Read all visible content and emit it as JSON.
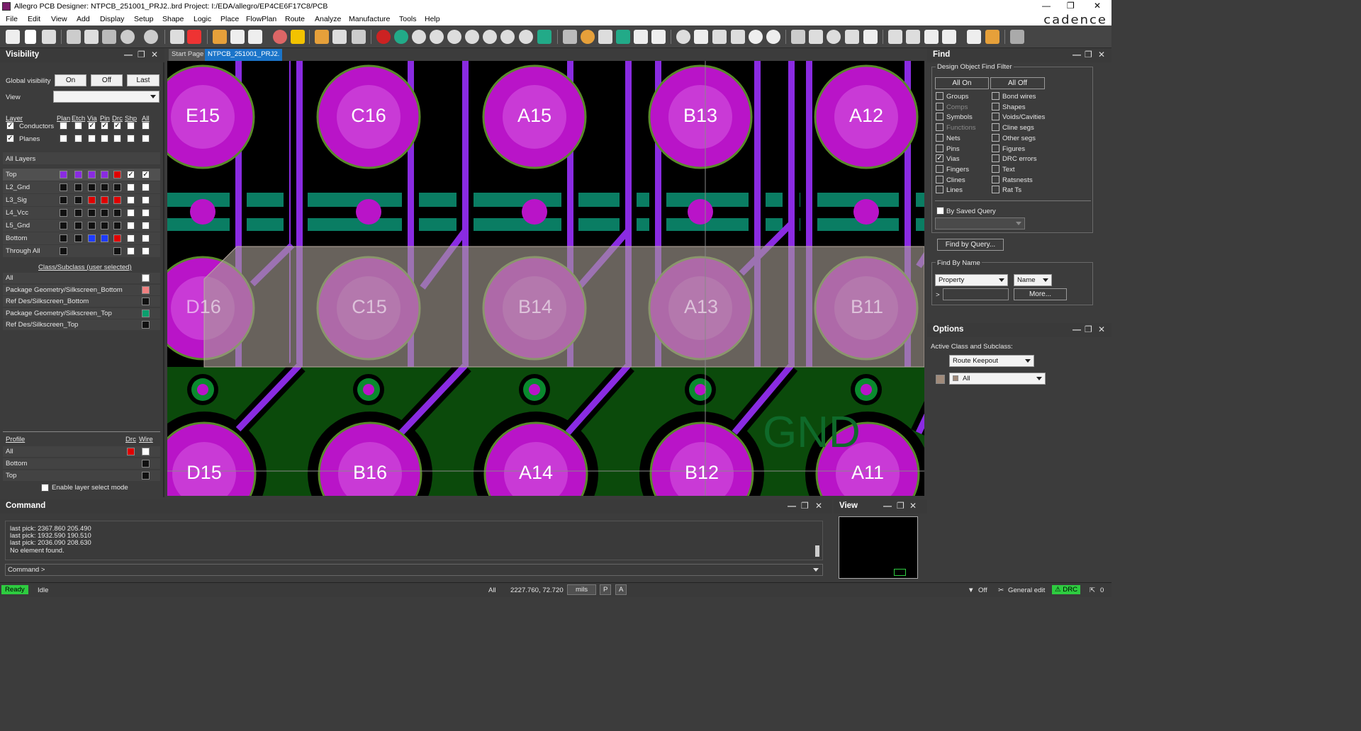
{
  "window": {
    "title": "Allegro PCB Designer: NTPCB_251001_PRJ2..brd  Project: I:/EDA/allegro/EP4CE6F17C8/PCB",
    "brand": "cadence"
  },
  "menu": [
    "File",
    "Edit",
    "View",
    "Add",
    "Display",
    "Setup",
    "Shape",
    "Logic",
    "Place",
    "FlowPlan",
    "Route",
    "Analyze",
    "Manufacture",
    "Tools",
    "Help"
  ],
  "visibility": {
    "title": "Visibility",
    "global_label": "Global visibility",
    "on": "On",
    "off": "Off",
    "last": "Last",
    "view_label": "View",
    "view_value": "",
    "headers": {
      "layer": "Layer",
      "plan": "Plan",
      "etch": "Etch",
      "via": "Via",
      "pin": "Pin",
      "drc": "Drc",
      "shp": "Shp",
      "all": "All"
    },
    "conductors": "Conductors",
    "planes": "Planes",
    "all_layers": "All Layers",
    "layers": [
      {
        "name": "Top",
        "colors": [
          "#8a2be2",
          "#8a2be2",
          "#8a2be2",
          "#8a2be2",
          "#e00000"
        ]
      },
      {
        "name": "L2_Gnd",
        "colors": [
          "#111",
          "#111",
          "#111",
          "#111",
          "#111"
        ]
      },
      {
        "name": "L3_Sig",
        "colors": [
          "#111",
          "#111",
          "#e00000",
          "#e00000",
          "#e00000"
        ]
      },
      {
        "name": "L4_Vcc",
        "colors": [
          "#111",
          "#111",
          "#111",
          "#111",
          "#111"
        ]
      },
      {
        "name": "L5_Gnd",
        "colors": [
          "#111",
          "#111",
          "#111",
          "#111",
          "#111"
        ]
      },
      {
        "name": "Bottom",
        "colors": [
          "#111",
          "#111",
          "#1e3cff",
          "#1e3cff",
          "#e00000"
        ]
      },
      {
        "name": "Through All",
        "colors": [
          "#111",
          "",
          "",
          "",
          "#111"
        ]
      }
    ],
    "class_header": "Class/Subclass (user selected)",
    "classes": [
      {
        "name": "All",
        "color": "#ffffff"
      },
      {
        "name": "Package Geometry/Silkscreen_Bottom",
        "color": "#f08080"
      },
      {
        "name": "Ref Des/Silkscreen_Bottom",
        "color": "#111111"
      },
      {
        "name": "Package Geometry/Silkscreen_Top",
        "color": "#0aa06e"
      },
      {
        "name": "Ref Des/Silkscreen_Top",
        "color": "#111111"
      }
    ],
    "profile_header": "Profile",
    "profile_drc": "Drc",
    "profile_wire": "Wire",
    "profiles": [
      "All",
      "Bottom",
      "Top"
    ],
    "enable_layer_select": "Enable layer select mode"
  },
  "tabs": [
    "Start Page",
    "NTPCB_251001_PRJ2."
  ],
  "board": {
    "row1": [
      "E15",
      "C16",
      "A15",
      "B13",
      "A12"
    ],
    "row2": [
      "D16",
      "C15",
      "B14",
      "A13",
      "B11"
    ],
    "row3": [
      "D15",
      "B16",
      "A14",
      "B12",
      "A11"
    ],
    "net_text": "GND"
  },
  "find": {
    "title": "Find",
    "filter_title": "Design Object Find Filter",
    "all_on": "All On",
    "all_off": "All Off",
    "left": [
      {
        "label": "Groups",
        "checked": false,
        "dim": false
      },
      {
        "label": "Comps",
        "checked": false,
        "dim": true
      },
      {
        "label": "Symbols",
        "checked": false,
        "dim": false
      },
      {
        "label": "Functions",
        "checked": false,
        "dim": true
      },
      {
        "label": "Nets",
        "checked": false,
        "dim": false
      },
      {
        "label": "Pins",
        "checked": false,
        "dim": false
      },
      {
        "label": "Vias",
        "checked": true,
        "dim": false
      },
      {
        "label": "Fingers",
        "checked": false,
        "dim": false
      },
      {
        "label": "Clines",
        "checked": false,
        "dim": false
      },
      {
        "label": "Lines",
        "checked": false,
        "dim": false
      }
    ],
    "right": [
      {
        "label": "Bond wires",
        "checked": false
      },
      {
        "label": "Shapes",
        "checked": false
      },
      {
        "label": "Voids/Cavities",
        "checked": false
      },
      {
        "label": "Cline segs",
        "checked": false
      },
      {
        "label": "Other segs",
        "checked": false
      },
      {
        "label": "Figures",
        "checked": false
      },
      {
        "label": "DRC errors",
        "checked": false
      },
      {
        "label": "Text",
        "checked": false
      },
      {
        "label": "Ratsnests",
        "checked": false
      },
      {
        "label": "Rat Ts",
        "checked": false
      }
    ],
    "by_saved_query": "By Saved Query",
    "find_by_query": "Find by Query...",
    "find_by_name": "Find By Name",
    "property": "Property",
    "name": "Name",
    "prompt": ">",
    "more": "More..."
  },
  "options": {
    "title": "Options",
    "active_label": "Active Class and Subclass:",
    "class_value": "Route Keepout",
    "subclass_value": "All"
  },
  "command": {
    "title": "Command",
    "lines": [
      "last pick:  2367.860 205.490",
      "last pick:  1932.590 190.510",
      "last pick:  2036.090 208.630",
      "No element found."
    ],
    "prompt": "Command >"
  },
  "viewpanel": {
    "title": "View"
  },
  "status": {
    "ready": "Ready",
    "idle": "Idle",
    "filter": "All",
    "coords": "2227.760, 72.720",
    "units": "mils",
    "p": "P",
    "a": "A",
    "off": "Off",
    "mode": "General edit",
    "drc": "DRC",
    "count": "0"
  }
}
